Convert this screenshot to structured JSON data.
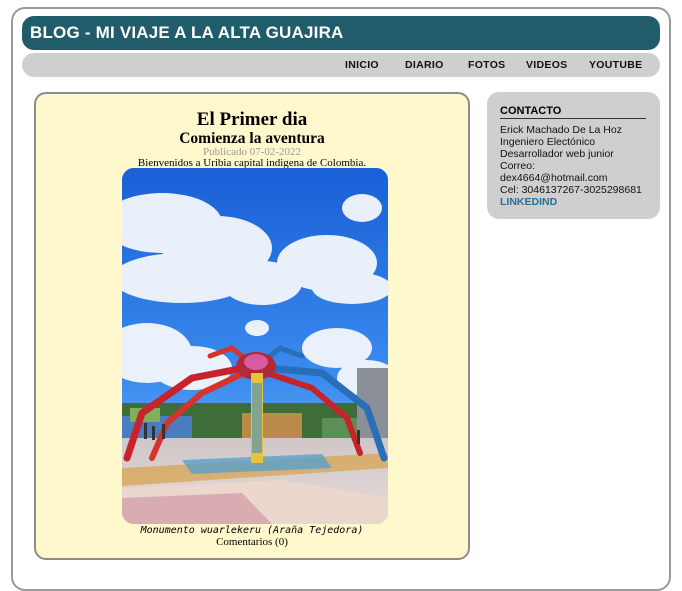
{
  "header": {
    "title": "BLOG - MI VIAJE A LA ALTA GUAJIRA"
  },
  "nav": {
    "items": [
      {
        "label": "INICIO"
      },
      {
        "label": "DIARIO"
      },
      {
        "label": "FOTOS"
      },
      {
        "label": "VIDEOS"
      },
      {
        "label": "YOUTUBE"
      }
    ]
  },
  "post": {
    "title": "El Primer dia",
    "subtitle": "Comienza la aventura",
    "date": "Publicado 07-02-2022",
    "intro": "Bienvenidos a Uribia capital indigena de Colombia.",
    "caption": "Monumento wuarlekeru (Araña Tejedora)",
    "comments": "Comentarios (0)"
  },
  "sidebar": {
    "title": "CONTACTO",
    "lines": [
      "Erick Machado De La Hoz",
      "Ingeniero Electónico",
      "Desarrollador web junior",
      "Correo:",
      "dex4664@hotmail.com",
      "Cel: 3046137267-3025298681"
    ],
    "link": "LINKEDIND"
  },
  "colors": {
    "header_bg": "#215c6b",
    "nav_bg": "#cfcfcf",
    "post_bg": "#fff8cc",
    "link": "#2a6f9a"
  }
}
